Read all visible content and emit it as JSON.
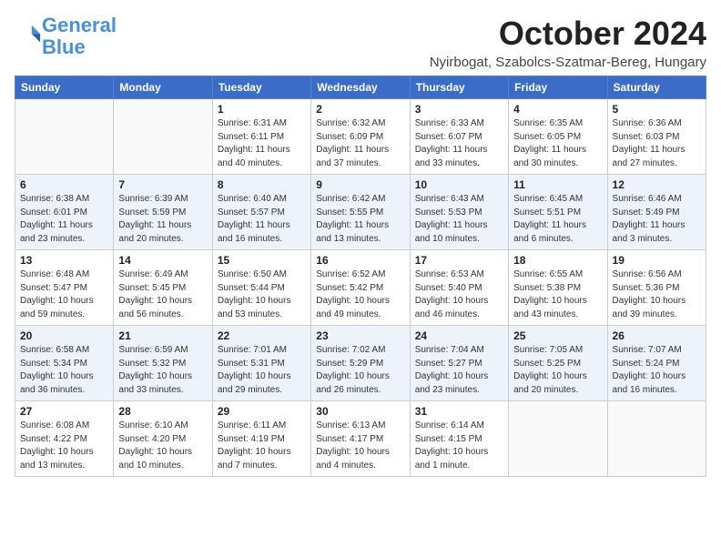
{
  "logo": {
    "line1": "General",
    "line2": "Blue"
  },
  "title": "October 2024",
  "location": "Nyirbogat, Szabolcs-Szatmar-Bereg, Hungary",
  "weekdays": [
    "Sunday",
    "Monday",
    "Tuesday",
    "Wednesday",
    "Thursday",
    "Friday",
    "Saturday"
  ],
  "weeks": [
    [
      {
        "day": "",
        "info": ""
      },
      {
        "day": "",
        "info": ""
      },
      {
        "day": "1",
        "info": "Sunrise: 6:31 AM\nSunset: 6:11 PM\nDaylight: 11 hours and 40 minutes."
      },
      {
        "day": "2",
        "info": "Sunrise: 6:32 AM\nSunset: 6:09 PM\nDaylight: 11 hours and 37 minutes."
      },
      {
        "day": "3",
        "info": "Sunrise: 6:33 AM\nSunset: 6:07 PM\nDaylight: 11 hours and 33 minutes."
      },
      {
        "day": "4",
        "info": "Sunrise: 6:35 AM\nSunset: 6:05 PM\nDaylight: 11 hours and 30 minutes."
      },
      {
        "day": "5",
        "info": "Sunrise: 6:36 AM\nSunset: 6:03 PM\nDaylight: 11 hours and 27 minutes."
      }
    ],
    [
      {
        "day": "6",
        "info": "Sunrise: 6:38 AM\nSunset: 6:01 PM\nDaylight: 11 hours and 23 minutes."
      },
      {
        "day": "7",
        "info": "Sunrise: 6:39 AM\nSunset: 5:59 PM\nDaylight: 11 hours and 20 minutes."
      },
      {
        "day": "8",
        "info": "Sunrise: 6:40 AM\nSunset: 5:57 PM\nDaylight: 11 hours and 16 minutes."
      },
      {
        "day": "9",
        "info": "Sunrise: 6:42 AM\nSunset: 5:55 PM\nDaylight: 11 hours and 13 minutes."
      },
      {
        "day": "10",
        "info": "Sunrise: 6:43 AM\nSunset: 5:53 PM\nDaylight: 11 hours and 10 minutes."
      },
      {
        "day": "11",
        "info": "Sunrise: 6:45 AM\nSunset: 5:51 PM\nDaylight: 11 hours and 6 minutes."
      },
      {
        "day": "12",
        "info": "Sunrise: 6:46 AM\nSunset: 5:49 PM\nDaylight: 11 hours and 3 minutes."
      }
    ],
    [
      {
        "day": "13",
        "info": "Sunrise: 6:48 AM\nSunset: 5:47 PM\nDaylight: 10 hours and 59 minutes."
      },
      {
        "day": "14",
        "info": "Sunrise: 6:49 AM\nSunset: 5:45 PM\nDaylight: 10 hours and 56 minutes."
      },
      {
        "day": "15",
        "info": "Sunrise: 6:50 AM\nSunset: 5:44 PM\nDaylight: 10 hours and 53 minutes."
      },
      {
        "day": "16",
        "info": "Sunrise: 6:52 AM\nSunset: 5:42 PM\nDaylight: 10 hours and 49 minutes."
      },
      {
        "day": "17",
        "info": "Sunrise: 6:53 AM\nSunset: 5:40 PM\nDaylight: 10 hours and 46 minutes."
      },
      {
        "day": "18",
        "info": "Sunrise: 6:55 AM\nSunset: 5:38 PM\nDaylight: 10 hours and 43 minutes."
      },
      {
        "day": "19",
        "info": "Sunrise: 6:56 AM\nSunset: 5:36 PM\nDaylight: 10 hours and 39 minutes."
      }
    ],
    [
      {
        "day": "20",
        "info": "Sunrise: 6:58 AM\nSunset: 5:34 PM\nDaylight: 10 hours and 36 minutes."
      },
      {
        "day": "21",
        "info": "Sunrise: 6:59 AM\nSunset: 5:32 PM\nDaylight: 10 hours and 33 minutes."
      },
      {
        "day": "22",
        "info": "Sunrise: 7:01 AM\nSunset: 5:31 PM\nDaylight: 10 hours and 29 minutes."
      },
      {
        "day": "23",
        "info": "Sunrise: 7:02 AM\nSunset: 5:29 PM\nDaylight: 10 hours and 26 minutes."
      },
      {
        "day": "24",
        "info": "Sunrise: 7:04 AM\nSunset: 5:27 PM\nDaylight: 10 hours and 23 minutes."
      },
      {
        "day": "25",
        "info": "Sunrise: 7:05 AM\nSunset: 5:25 PM\nDaylight: 10 hours and 20 minutes."
      },
      {
        "day": "26",
        "info": "Sunrise: 7:07 AM\nSunset: 5:24 PM\nDaylight: 10 hours and 16 minutes."
      }
    ],
    [
      {
        "day": "27",
        "info": "Sunrise: 6:08 AM\nSunset: 4:22 PM\nDaylight: 10 hours and 13 minutes."
      },
      {
        "day": "28",
        "info": "Sunrise: 6:10 AM\nSunset: 4:20 PM\nDaylight: 10 hours and 10 minutes."
      },
      {
        "day": "29",
        "info": "Sunrise: 6:11 AM\nSunset: 4:19 PM\nDaylight: 10 hours and 7 minutes."
      },
      {
        "day": "30",
        "info": "Sunrise: 6:13 AM\nSunset: 4:17 PM\nDaylight: 10 hours and 4 minutes."
      },
      {
        "day": "31",
        "info": "Sunrise: 6:14 AM\nSunset: 4:15 PM\nDaylight: 10 hours and 1 minute."
      },
      {
        "day": "",
        "info": ""
      },
      {
        "day": "",
        "info": ""
      }
    ]
  ]
}
